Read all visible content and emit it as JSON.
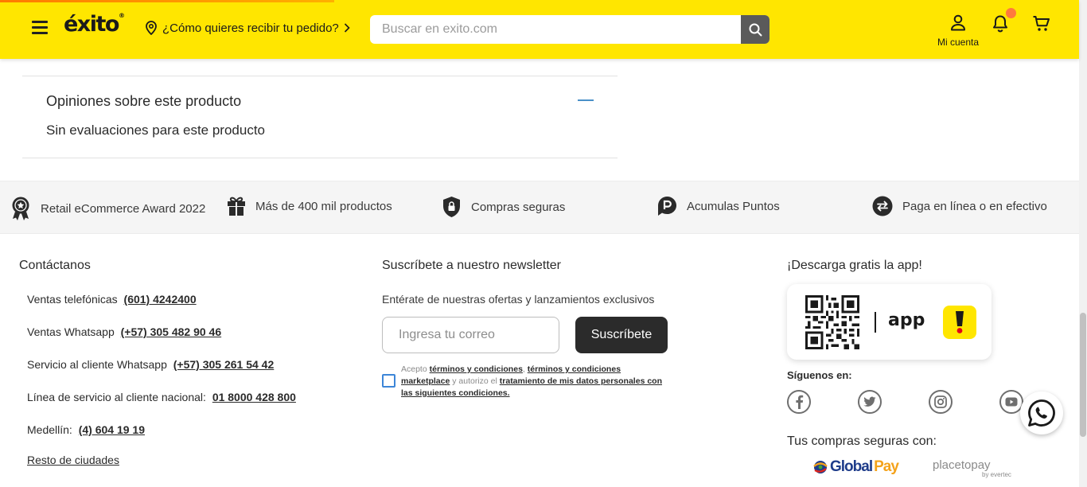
{
  "header": {
    "logo": "éxito",
    "logo_mark": "®",
    "delivery_text": "¿Cómo quieres recibir tu pedido?",
    "search_placeholder": "Buscar en exito.com",
    "account_label": "Mi cuenta",
    "brand_color": "#ffe600",
    "notification_dot_color": "#ff7a3d"
  },
  "reviews": {
    "title": "Opiniones sobre este producto",
    "empty_text": "Sin evaluaciones para este producto",
    "collapse_icon": "minus-icon"
  },
  "benefits": [
    {
      "icon": "award-ribbon-icon",
      "label": "Retail eCommerce Award 2022"
    },
    {
      "icon": "gift-icon",
      "label": "Más de 400 mil productos"
    },
    {
      "icon": "shield-lock-icon",
      "label": "Compras seguras"
    },
    {
      "icon": "points-p-icon",
      "label": "Acumulas Puntos"
    },
    {
      "icon": "exchange-arrows-icon",
      "label": "Paga en línea o en efectivo"
    }
  ],
  "contact": {
    "title": "Contáctanos",
    "rows": [
      {
        "label": "Ventas telefónicas",
        "value": "(601) 4242400"
      },
      {
        "label": "Ventas Whatsapp",
        "value": "(+57) 305 482 90 46"
      },
      {
        "label": "Servicio al cliente Whatsapp",
        "value": "(+57) 305 261 54 42"
      },
      {
        "label": "Línea de servicio al cliente nacional:",
        "value": "01 8000 428 800"
      },
      {
        "label": "Medellín:",
        "value": "(4) 604 19 19"
      }
    ],
    "rest_link": "Resto de ciudades"
  },
  "newsletter": {
    "title": "Suscríbete a nuestro newsletter",
    "subtitle": "Entérate de nuestras ofertas y lanzamientos exclusivos",
    "email_placeholder": "Ingresa tu correo",
    "button_label": "Suscríbete",
    "terms_prefix": "Acepto",
    "terms_link1": "términos y condiciones",
    "terms_link2": "términos y condiciones marketplace",
    "terms_mid": "y autorizo el",
    "terms_link3": "tratamiento de mis datos personales con las siguientes condiciones."
  },
  "app": {
    "title": "¡Descarga gratis la app!",
    "app_text": "app",
    "app_icon_glyph": "!"
  },
  "social": {
    "title": "Síguenos en:",
    "networks": [
      "facebook-icon",
      "twitter-icon",
      "instagram-icon",
      "youtube-icon"
    ]
  },
  "payments": {
    "title": "Tus compras seguras con:",
    "globalpay_a": "Global",
    "globalpay_b": "Pay",
    "placetopay": "placetopay",
    "placetopay_sub": "by evertec"
  }
}
